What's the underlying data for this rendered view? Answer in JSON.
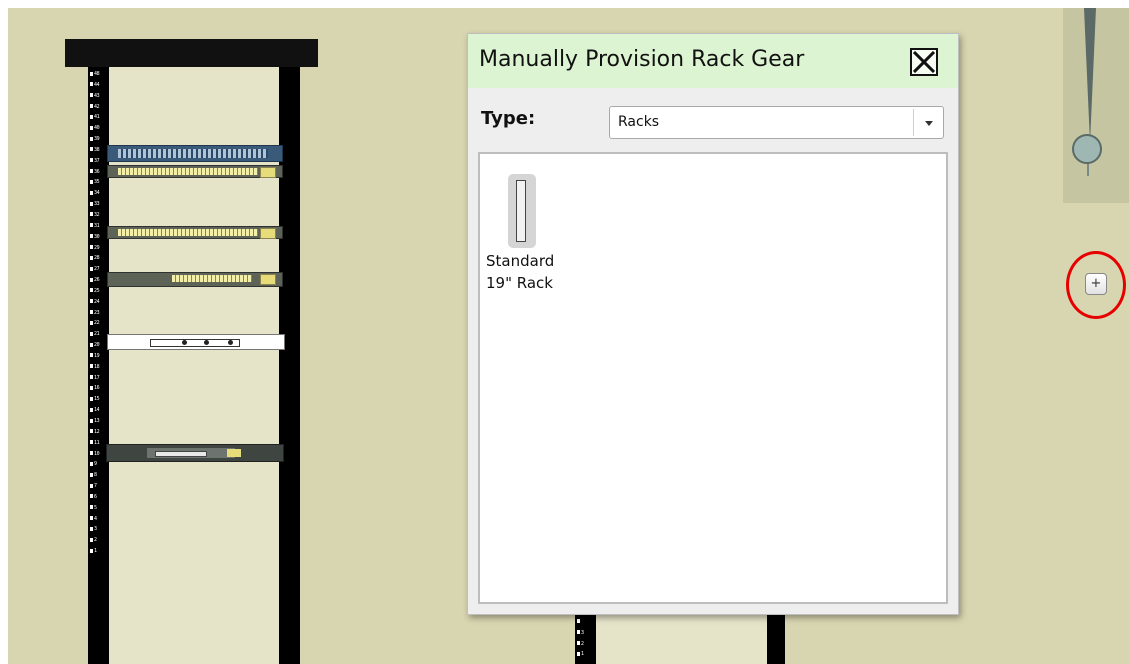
{
  "dialog": {
    "title": "Manually Provision Rack Gear",
    "close_icon": "close-box-icon",
    "type_label": "Type:",
    "type_select": {
      "selected": "Racks"
    },
    "items": [
      {
        "label_line1": "Standard",
        "label_line2": "19\" Rack",
        "icon": "rack-icon"
      }
    ]
  },
  "zoom": {
    "plus_label": "+",
    "level": 0.7
  },
  "rack1": {
    "unit_labels": [
      "48",
      "44",
      "43",
      "42",
      "41",
      "40",
      "39",
      "38",
      "37",
      "36",
      "35",
      "34",
      "33",
      "32",
      "31",
      "30",
      "29",
      "28",
      "27",
      "26",
      "25",
      "24",
      "23",
      "22",
      "21",
      "20",
      "19",
      "18",
      "17",
      "16",
      "15",
      "14",
      "13",
      "12",
      "11",
      "10",
      "9",
      "8",
      "7",
      "6",
      "5",
      "4",
      "3",
      "2",
      "1"
    ]
  },
  "rack2": {
    "unit_labels": [
      "28",
      "",
      "3",
      "2",
      "1"
    ]
  },
  "colors": {
    "canvas": "#d8d6b0",
    "dialog_header": "#dcf4d2",
    "highlight": "#e60000"
  }
}
